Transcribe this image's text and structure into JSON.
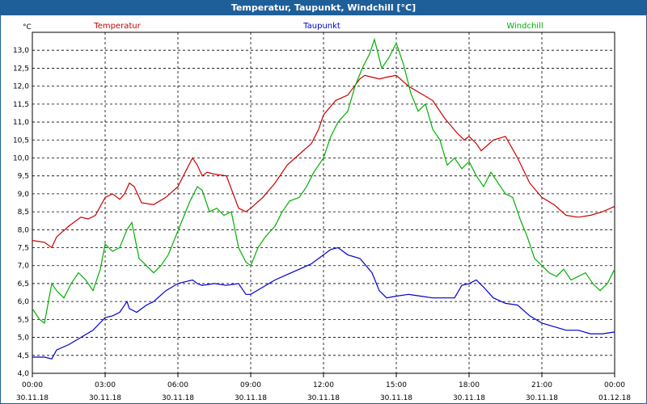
{
  "window": {
    "title": "Temperatur, Taupunkt, Windchill [°C]"
  },
  "chart_data": {
    "type": "line",
    "title": "Temperatur, Taupunkt, Windchill [°C]",
    "ylabel": "°C",
    "ylim": [
      4.0,
      13.5
    ],
    "xlim": [
      0,
      24
    ],
    "grid": true,
    "y_ticks": [
      "4,0",
      "4,5",
      "5,0",
      "5,5",
      "6,0",
      "6,5",
      "7,0",
      "7,5",
      "8,0",
      "8,5",
      "9,0",
      "9,5",
      "10,0",
      "10,5",
      "11,0",
      "11,5",
      "12,0",
      "12,5",
      "13,0"
    ],
    "x_ticks": [
      {
        "time": "00:00",
        "date": "30.11.18"
      },
      {
        "time": "03:00",
        "date": "30.11.18"
      },
      {
        "time": "06:00",
        "date": "30.11.18"
      },
      {
        "time": "09:00",
        "date": "30.11.18"
      },
      {
        "time": "12:00",
        "date": "30.11.18"
      },
      {
        "time": "15:00",
        "date": "30.11.18"
      },
      {
        "time": "18:00",
        "date": "30.11.18"
      },
      {
        "time": "21:00",
        "date": "30.11.18"
      },
      {
        "time": "00:00",
        "date": "01.12.18"
      }
    ],
    "series": [
      {
        "name": "Temperatur",
        "color": "#cc0000",
        "x": [
          0,
          0.5,
          0.8,
          1.0,
          1.5,
          2.0,
          2.3,
          2.6,
          3.0,
          3.3,
          3.6,
          3.8,
          4.0,
          4.2,
          4.5,
          5.0,
          5.5,
          6.0,
          6.3,
          6.6,
          6.8,
          7.0,
          7.2,
          7.5,
          8.0,
          8.5,
          8.8,
          9.0,
          9.5,
          10.0,
          10.5,
          11.0,
          11.5,
          11.8,
          12.0,
          12.5,
          13.0,
          13.5,
          13.7,
          14.0,
          14.3,
          14.6,
          15.0,
          15.5,
          16.0,
          16.5,
          17.0,
          17.5,
          17.8,
          18.0,
          18.3,
          18.5,
          19.0,
          19.5,
          20.0,
          20.5,
          21.0,
          21.5,
          22.0,
          22.5,
          23.0,
          23.5,
          24.0
        ],
        "y": [
          7.7,
          7.65,
          7.5,
          7.8,
          8.1,
          8.35,
          8.3,
          8.4,
          8.9,
          9.0,
          8.85,
          9.0,
          9.3,
          9.2,
          8.75,
          8.7,
          8.9,
          9.2,
          9.6,
          10.0,
          9.8,
          9.5,
          9.6,
          9.55,
          9.5,
          8.6,
          8.5,
          8.6,
          8.9,
          9.3,
          9.8,
          10.1,
          10.4,
          10.8,
          11.2,
          11.6,
          11.75,
          12.2,
          12.3,
          12.25,
          12.2,
          12.25,
          12.3,
          12.0,
          11.8,
          11.6,
          11.1,
          10.7,
          10.5,
          10.6,
          10.4,
          10.2,
          10.5,
          10.6,
          10.0,
          9.3,
          8.9,
          8.7,
          8.4,
          8.35,
          8.4,
          8.5,
          8.65
        ]
      },
      {
        "name": "Taupunkt",
        "color": "#0000cc",
        "x": [
          0,
          0.5,
          0.8,
          1.0,
          1.5,
          2.0,
          2.5,
          3.0,
          3.3,
          3.6,
          3.9,
          4.0,
          4.3,
          4.7,
          5.0,
          5.5,
          6.0,
          6.3,
          6.6,
          6.8,
          7.0,
          7.5,
          8.0,
          8.5,
          8.8,
          9.0,
          9.5,
          10.0,
          10.5,
          11.0,
          11.5,
          11.9,
          12.3,
          12.6,
          13.0,
          13.5,
          14.0,
          14.3,
          14.6,
          15.0,
          15.5,
          16.0,
          16.5,
          17.0,
          17.4,
          17.7,
          18.0,
          18.3,
          18.6,
          19.0,
          19.5,
          20.0,
          20.5,
          21.0,
          21.5,
          22.0,
          22.5,
          23.0,
          23.5,
          24.0
        ],
        "y": [
          4.45,
          4.45,
          4.4,
          4.65,
          4.8,
          5.0,
          5.2,
          5.55,
          5.6,
          5.7,
          6.0,
          5.8,
          5.7,
          5.9,
          6.0,
          6.3,
          6.5,
          6.55,
          6.6,
          6.5,
          6.45,
          6.5,
          6.45,
          6.5,
          6.2,
          6.2,
          6.4,
          6.6,
          6.75,
          6.9,
          7.05,
          7.25,
          7.45,
          7.5,
          7.3,
          7.2,
          6.8,
          6.3,
          6.1,
          6.15,
          6.2,
          6.15,
          6.1,
          6.1,
          6.1,
          6.45,
          6.5,
          6.6,
          6.4,
          6.1,
          5.95,
          5.9,
          5.6,
          5.4,
          5.3,
          5.2,
          5.2,
          5.1,
          5.1,
          5.15
        ]
      },
      {
        "name": "Windchill",
        "color": "#00b000",
        "x": [
          0,
          0.3,
          0.5,
          0.8,
          1.0,
          1.3,
          1.6,
          1.9,
          2.2,
          2.5,
          2.8,
          3.0,
          3.3,
          3.6,
          3.9,
          4.1,
          4.4,
          4.7,
          5.0,
          5.3,
          5.6,
          5.9,
          6.2,
          6.5,
          6.8,
          7.0,
          7.3,
          7.6,
          7.9,
          8.2,
          8.5,
          8.8,
          9.0,
          9.3,
          9.6,
          10.0,
          10.3,
          10.6,
          11.0,
          11.3,
          11.6,
          12.0,
          12.3,
          12.6,
          13.0,
          13.3,
          13.6,
          13.9,
          14.1,
          14.4,
          14.7,
          15.0,
          15.3,
          15.6,
          15.9,
          16.2,
          16.5,
          16.8,
          17.1,
          17.4,
          17.7,
          18.0,
          18.3,
          18.6,
          18.9,
          19.2,
          19.5,
          19.8,
          20.1,
          20.4,
          20.7,
          21.0,
          21.3,
          21.6,
          21.9,
          22.2,
          22.5,
          22.8,
          23.1,
          23.4,
          23.7,
          24.0
        ],
        "y": [
          5.8,
          5.5,
          5.4,
          6.5,
          6.3,
          6.1,
          6.5,
          6.8,
          6.6,
          6.3,
          6.9,
          7.6,
          7.4,
          7.5,
          8.0,
          8.2,
          7.2,
          7.0,
          6.8,
          7.0,
          7.3,
          7.8,
          8.3,
          8.8,
          9.2,
          9.1,
          8.5,
          8.6,
          8.4,
          8.5,
          7.5,
          7.1,
          7.0,
          7.5,
          7.8,
          8.1,
          8.5,
          8.8,
          8.9,
          9.2,
          9.6,
          10.0,
          10.6,
          11.0,
          11.3,
          12.0,
          12.5,
          12.9,
          13.3,
          12.5,
          12.8,
          13.2,
          12.6,
          11.8,
          11.3,
          11.5,
          10.8,
          10.5,
          9.8,
          10.0,
          9.7,
          9.9,
          9.5,
          9.2,
          9.6,
          9.3,
          9.0,
          8.9,
          8.3,
          7.8,
          7.2,
          7.0,
          6.8,
          6.7,
          6.9,
          6.6,
          6.7,
          6.8,
          6.5,
          6.3,
          6.5,
          6.9
        ]
      }
    ]
  }
}
